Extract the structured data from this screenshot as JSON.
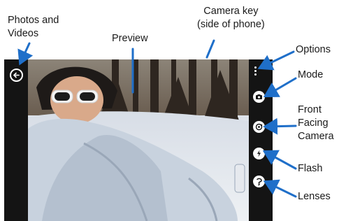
{
  "callouts": {
    "photos_videos": "Photos and\nVideos",
    "preview": "Preview",
    "camera_key": "Camera key\n(side of phone)",
    "options": "Options",
    "mode": "Mode",
    "front_facing": "Front\nFacing\nCamera",
    "flash": "Flash",
    "lenses": "Lenses"
  },
  "icons": {
    "back": "arrow-left-icon",
    "options": "more-options-icon",
    "mode": "camera-mode-icon",
    "front_camera": "switch-camera-icon",
    "flash": "flash-icon",
    "lenses": "lenses-icon"
  },
  "colors": {
    "screen_bg": "#141414",
    "callout_line": "#1f6fc9",
    "icon_fill": "#ffffff"
  }
}
